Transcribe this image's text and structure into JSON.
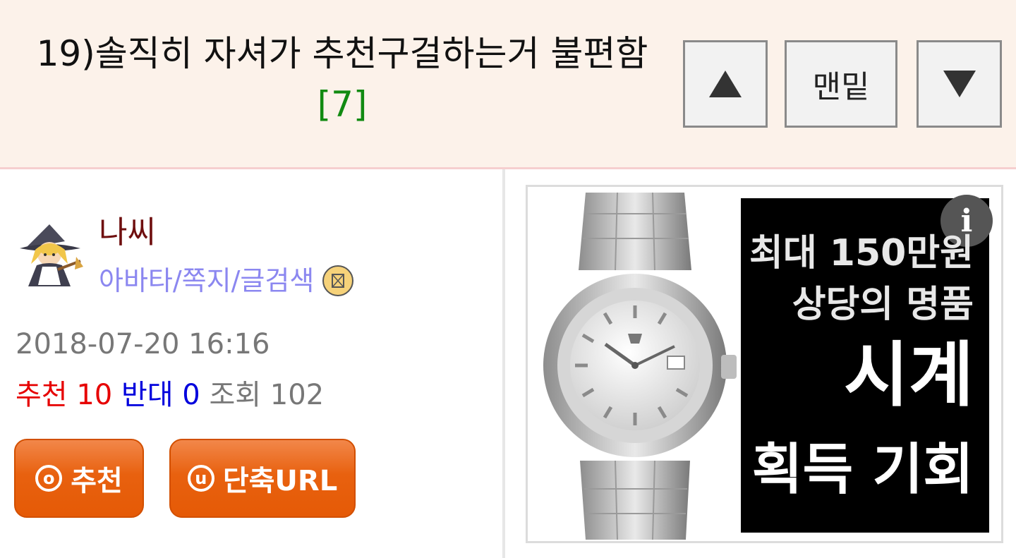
{
  "header": {
    "title": "19)솔직히 자셔가 추천구걸하는거 불편함",
    "comment_count": "[7]",
    "up_icon": "triangle-up-icon",
    "bottom_label": "맨밑",
    "down_icon": "triangle-down-icon"
  },
  "author": {
    "name": "나씨",
    "links": "아바타/쪽지/글검색",
    "mail_icon": "envelope-icon"
  },
  "post": {
    "date": "2018-07-20 16:16",
    "recommend_label": "추천",
    "recommend_count": "10",
    "oppose_label": "반대",
    "oppose_count": "0",
    "views_label": "조회",
    "views_count": "102"
  },
  "buttons": {
    "recommend_icon_letter": "o",
    "recommend": "추천",
    "shorturl_icon_letter": "u",
    "shorturl": "단축URL"
  },
  "ad": {
    "info": "i",
    "line1": "최대 150만원",
    "line2": "상당의 명품",
    "line3": "시계",
    "line4": "획득 기회"
  },
  "colors": {
    "header_bg": "#fcf2ea",
    "accent_orange": "#e8610f",
    "count_green": "#118a11",
    "link_purple": "#8b87f0"
  }
}
